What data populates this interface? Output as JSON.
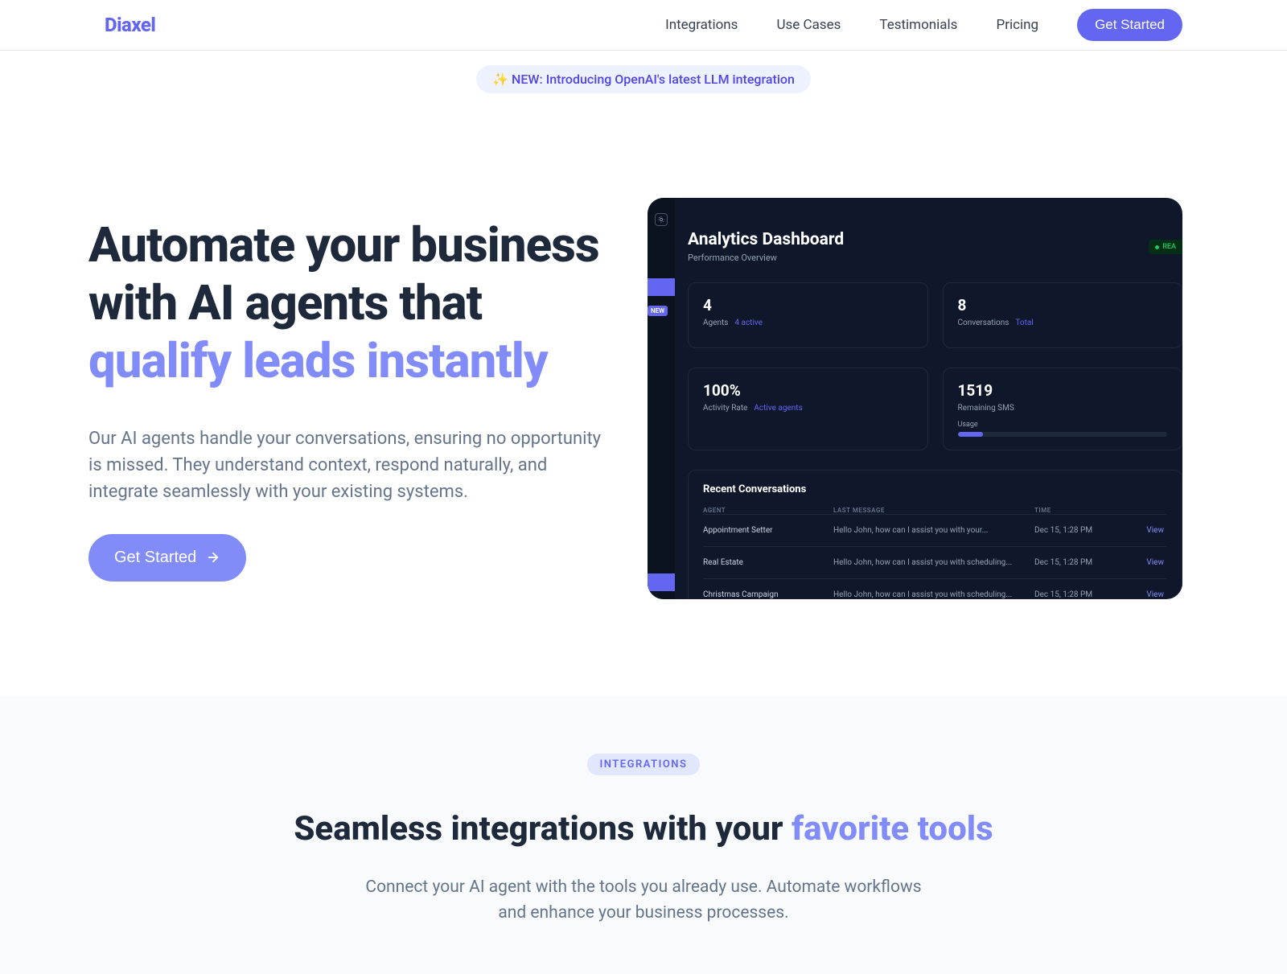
{
  "nav": {
    "logo": "Diaxel",
    "links": [
      "Integrations",
      "Use Cases",
      "Testimonials",
      "Pricing"
    ],
    "cta": "Get Started"
  },
  "announce": {
    "emoji": "✨",
    "text": "NEW: Introducing OpenAI's latest LLM integration"
  },
  "hero": {
    "title_line1": "Automate your business with AI agents that",
    "title_accent": "qualify leads instantly",
    "desc": "Our AI agents handle your conversations, ensuring no opportunity is missed. They understand context, respond naturally, and integrate seamlessly with your existing systems.",
    "cta": "Get Started"
  },
  "dash": {
    "title": "Analytics Dashboard",
    "subtitle": "Performance Overview",
    "status": "REA",
    "sidebar_new": "NEW",
    "cards": [
      {
        "num": "4",
        "label": "Agents",
        "sub": "4 active"
      },
      {
        "num": "8",
        "label": "Conversations",
        "sub": "Total"
      },
      {
        "num": "100%",
        "label": "Activity Rate",
        "sub": "Active agents"
      },
      {
        "num": "1519",
        "label": "Remaining SMS",
        "sub": "",
        "usage": "Usage"
      }
    ],
    "recent_title": "Recent Conversations",
    "headers": {
      "agent": "AGENT",
      "msg": "LAST MESSAGE",
      "time": "TIME"
    },
    "rows": [
      {
        "agent": "Appointment Setter",
        "msg": "Hello John, how can I assist you with your...",
        "time": "Dec 15, 1:28 PM",
        "action": "View"
      },
      {
        "agent": "Real Estate",
        "msg": "Hello John, how can I assist you with scheduling...",
        "time": "Dec 15, 1:28 PM",
        "action": "View"
      },
      {
        "agent": "Christmas Campaign",
        "msg": "Hello John, how can I assist you with scheduling...",
        "time": "Dec 15, 1:28 PM",
        "action": "View"
      }
    ]
  },
  "integrations": {
    "pill": "INTEGRATIONS",
    "title_1": "Seamless integrations with your ",
    "title_accent": "favorite tools",
    "desc": "Connect your AI agent with the tools you already use. Automate workflows and enhance your business processes."
  }
}
